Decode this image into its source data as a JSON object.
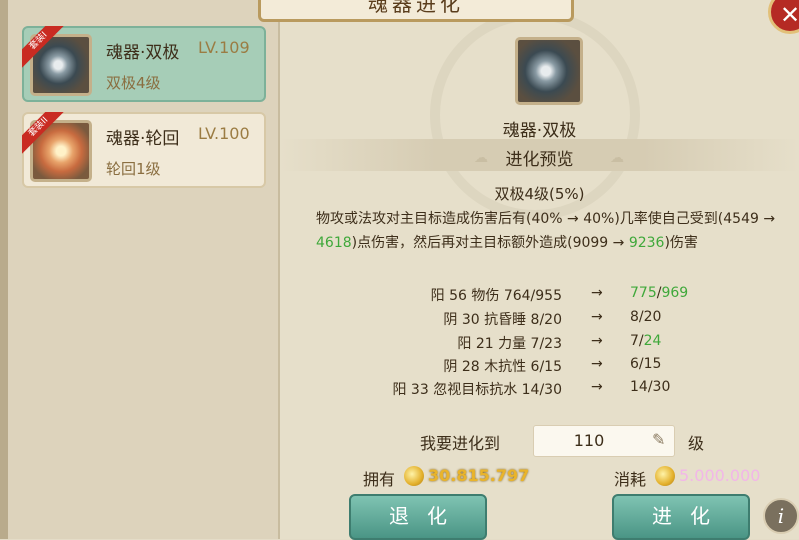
{
  "window": {
    "title": "魂器进化",
    "close_glyph": "✕"
  },
  "items": [
    {
      "ribbon": "套装I",
      "name": "魂器·双极",
      "level": "LV.109",
      "sub": "双极4级",
      "selected": true
    },
    {
      "ribbon": "套装II",
      "name": "魂器·轮回",
      "level": "LV.100",
      "sub": "轮回1级",
      "selected": false
    }
  ],
  "main": {
    "name": "魂器·双极",
    "preview_title": "进化预览"
  },
  "effect": {
    "level": "双极4级(5%)",
    "desc_parts": [
      "物攻或法攻对主目标造成伤害后有(40% → 40%)几率使自己受到(4549 → ",
      "4618",
      ")点伤害，然后再对主目标额外造成(9099 → ",
      "9236",
      ")伤害"
    ]
  },
  "stats": [
    {
      "name": "阳 56 物伤 764/955",
      "arrow": "→",
      "new_a": "775",
      "new_sep": "/",
      "new_b": "969",
      "a_green": true,
      "b_green": true
    },
    {
      "name": "阴 30 抗昏睡 8/20",
      "arrow": "→",
      "new_a": "8",
      "new_sep": "/",
      "new_b": "20",
      "a_green": false,
      "b_green": false
    },
    {
      "name": "阳 21 力量 7/23",
      "arrow": "→",
      "new_a": "7",
      "new_sep": "/",
      "new_b": "24",
      "a_green": false,
      "b_green": true
    },
    {
      "name": "阴 28 木抗性 6/15",
      "arrow": "→",
      "new_a": "6",
      "new_sep": "/",
      "new_b": "15",
      "a_green": false,
      "b_green": false
    },
    {
      "name": "阳 33 忽视目标抗水 14/30",
      "arrow": "→",
      "new_a": "14",
      "new_sep": "/",
      "new_b": "30",
      "a_green": false,
      "b_green": false
    }
  ],
  "target": {
    "label": "我要进化到",
    "value": "110",
    "unit": "级",
    "edit_glyph": "✎"
  },
  "currency": {
    "own_label": "拥有",
    "own_value": "30.815.797",
    "cost_label": "消耗",
    "cost_value": "5.000.000"
  },
  "buttons": {
    "back": "退化",
    "evolve": "进化",
    "info": "i"
  },
  "colors": {
    "accent_green": "#3fa83a",
    "gold": "#e9b42b",
    "pink": "#f2b6e8",
    "button_teal": "#4a9585"
  }
}
